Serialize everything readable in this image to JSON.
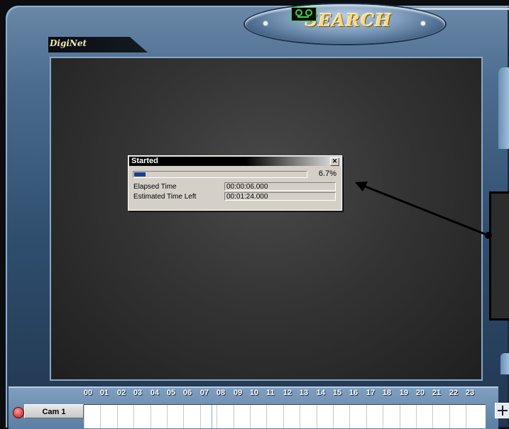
{
  "header": {
    "title": "SEARCH",
    "tape_icon": "videotape-icon",
    "brand": "DigiNet"
  },
  "dialog": {
    "title": "Started",
    "close_icon": "close-icon",
    "progress_fraction": 0.067,
    "progress_text": "6.7%",
    "rows": [
      {
        "label": "Elapsed Time",
        "value": "00:00:06.000"
      },
      {
        "label": "Estimated Time Left",
        "value": "00:01:24.000"
      }
    ]
  },
  "timeline": {
    "camera_label": "Cam 1",
    "hours": [
      "00",
      "01",
      "02",
      "03",
      "04",
      "05",
      "06",
      "07",
      "08",
      "09",
      "10",
      "11",
      "12",
      "13",
      "14",
      "15",
      "16",
      "17",
      "18",
      "19",
      "20",
      "21",
      "22",
      "23"
    ]
  },
  "colors": {
    "progress_fill": "#1f3d8a",
    "title_gold": "#f3d888",
    "tape_green": "#3fd33f"
  }
}
